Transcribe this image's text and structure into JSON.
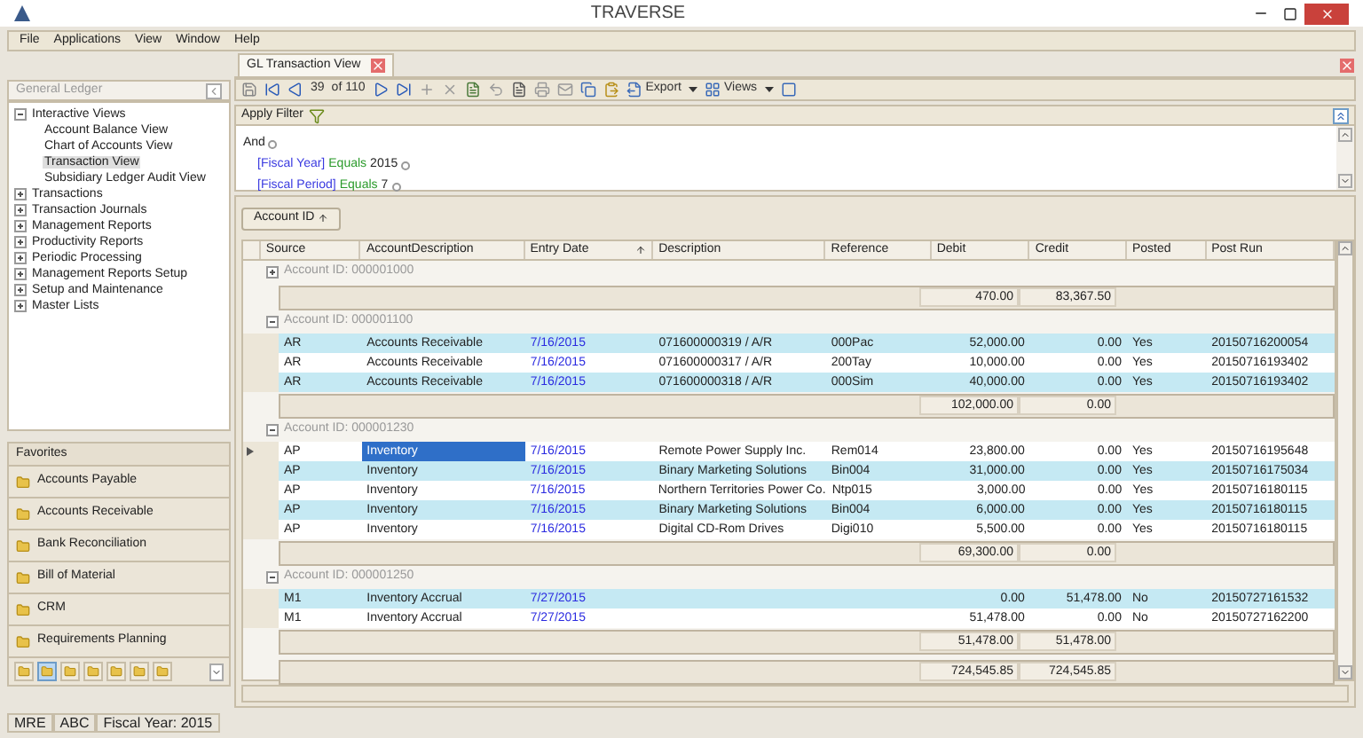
{
  "window": {
    "title": "TRAVERSE"
  },
  "menu": [
    "File",
    "Applications",
    "View",
    "Window",
    "Help"
  ],
  "sidebar": {
    "title": "General Ledger",
    "tree": [
      {
        "label": "Interactive Views",
        "expanded": true,
        "children": [
          {
            "label": "Account Balance View",
            "selected": false
          },
          {
            "label": "Chart of Accounts View",
            "selected": false
          },
          {
            "label": "Transaction View",
            "selected": true
          },
          {
            "label": "Subsidiary Ledger Audit View",
            "selected": false
          }
        ]
      },
      {
        "label": "Transactions",
        "expanded": false
      },
      {
        "label": "Transaction Journals",
        "expanded": false
      },
      {
        "label": "Management Reports",
        "expanded": false
      },
      {
        "label": "Productivity Reports",
        "expanded": false
      },
      {
        "label": "Periodic Processing",
        "expanded": false
      },
      {
        "label": "Management Reports Setup",
        "expanded": false
      },
      {
        "label": "Setup and Maintenance",
        "expanded": false
      },
      {
        "label": "Master Lists",
        "expanded": false
      }
    ],
    "favorites_title": "Favorites",
    "favorites": [
      "Accounts Payable",
      "Accounts Receivable",
      "Bank Reconciliation",
      "Bill of Material",
      "CRM",
      "Requirements Planning"
    ],
    "shortcuts": [
      {
        "selected": false
      },
      {
        "selected": true
      },
      {
        "selected": false
      },
      {
        "selected": false
      },
      {
        "selected": false
      },
      {
        "selected": false
      },
      {
        "selected": false
      }
    ]
  },
  "tab": {
    "label": "GL Transaction View"
  },
  "toolbar": {
    "record": "39",
    "of": "of 110",
    "export": "Export",
    "views": "Views"
  },
  "filter": {
    "label": "Apply Filter",
    "root": "And",
    "conditions": [
      {
        "field": "[Fiscal Year]",
        "op": "Equals",
        "value": "2015"
      },
      {
        "field": "[Fiscal Period]",
        "op": "Equals",
        "value": "7"
      }
    ]
  },
  "group_by": "Account ID",
  "table": {
    "columns": [
      "Source",
      "AccountDescription",
      "Entry Date",
      "Description",
      "Reference",
      "Debit",
      "Credit",
      "Posted",
      "Post Run"
    ],
    "groups": [
      {
        "label": "Account ID: 000001000",
        "expanded": false,
        "debit": "470.00",
        "credit": "83,367.50"
      },
      {
        "label": "Account ID: 000001100",
        "expanded": true,
        "rows": [
          {
            "selected": false,
            "cells": [
              "AR",
              "Accounts Receivable",
              "7/16/2015",
              "071600000319 / A/R",
              "000Pac",
              "52,000.00",
              "0.00",
              "Yes",
              "20150716200054"
            ]
          },
          {
            "selected": false,
            "cells": [
              "AR",
              "Accounts Receivable",
              "7/16/2015",
              "071600000317 / A/R",
              "200Tay",
              "10,000.00",
              "0.00",
              "Yes",
              "20150716193402"
            ]
          },
          {
            "selected": false,
            "cells": [
              "AR",
              "Accounts Receivable",
              "7/16/2015",
              "071600000318 / A/R",
              "000Sim",
              "40,000.00",
              "0.00",
              "Yes",
              "20150716193402"
            ]
          }
        ],
        "debit": "102,000.00",
        "credit": "0.00"
      },
      {
        "label": "Account ID: 000001230",
        "expanded": true,
        "rows": [
          {
            "selected": true,
            "cells": [
              "AP",
              "Inventory",
              "7/16/2015",
              "Remote Power Supply Inc.",
              "Rem014",
              "23,800.00",
              "0.00",
              "Yes",
              "20150716195648"
            ]
          },
          {
            "selected": false,
            "cells": [
              "AP",
              "Inventory",
              "7/16/2015",
              "Binary Marketing Solutions",
              "Bin004",
              "31,000.00",
              "0.00",
              "Yes",
              "20150716175034"
            ]
          },
          {
            "selected": false,
            "cells": [
              "AP",
              "Inventory",
              "7/16/2015",
              "Northern Territories Power Co.",
              "Ntp015",
              "3,000.00",
              "0.00",
              "Yes",
              "20150716180115"
            ]
          },
          {
            "selected": false,
            "cells": [
              "AP",
              "Inventory",
              "7/16/2015",
              "Binary Marketing Solutions",
              "Bin004",
              "6,000.00",
              "0.00",
              "Yes",
              "20150716180115"
            ]
          },
          {
            "selected": false,
            "cells": [
              "AP",
              "Inventory",
              "7/16/2015",
              "Digital CD-Rom Drives",
              "Digi010",
              "5,500.00",
              "0.00",
              "Yes",
              "20150716180115"
            ]
          }
        ],
        "debit": "69,300.00",
        "credit": "0.00"
      },
      {
        "label": "Account ID: 000001250",
        "expanded": true,
        "rows": [
          {
            "selected": false,
            "cells": [
              "M1",
              "Inventory Accrual",
              "7/27/2015",
              "",
              "",
              "0.00",
              "51,478.00",
              "No",
              "20150727161532"
            ]
          },
          {
            "selected": false,
            "cells": [
              "M1",
              "Inventory Accrual",
              "7/27/2015",
              "",
              "",
              "51,478.00",
              "0.00",
              "No",
              "20150727162200"
            ]
          }
        ],
        "debit": "51,478.00",
        "credit": "51,478.00"
      }
    ],
    "grand_debit": "724,545.85",
    "grand_credit": "724,545.85"
  },
  "status_bar": [
    "MRE",
    "ABC",
    "Fiscal Year: 2015"
  ]
}
